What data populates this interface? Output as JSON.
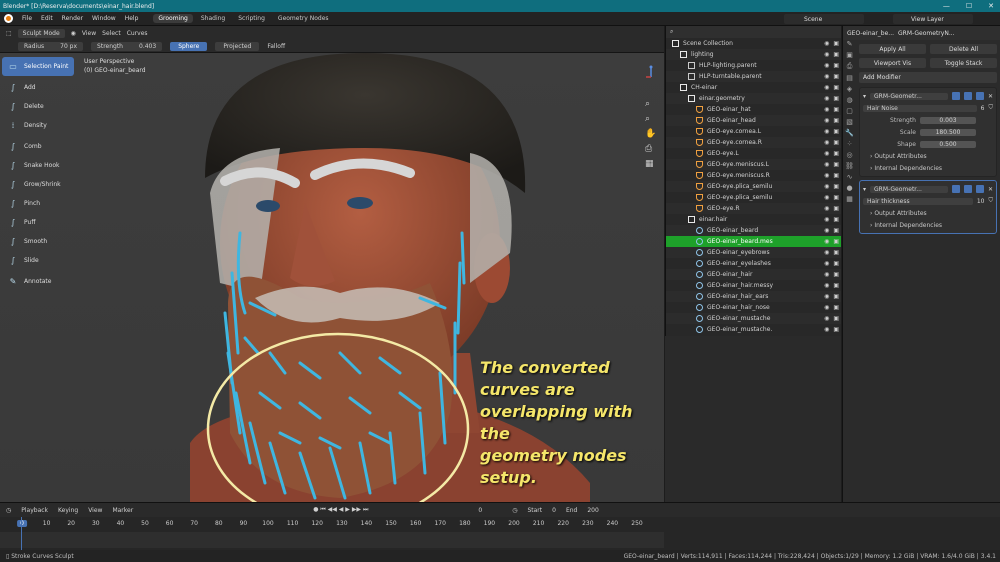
{
  "window": {
    "title": "Blender* [D:\\Reserva\\documents\\einar_hair.blend]",
    "buttons": [
      "—",
      "☐",
      "✕"
    ]
  },
  "menu": [
    "File",
    "Edit",
    "Render",
    "Window",
    "Help"
  ],
  "workspaces": [
    {
      "label": "Grooming",
      "active": true
    },
    {
      "label": "Shading",
      "active": false
    },
    {
      "label": "Scripting",
      "active": false
    },
    {
      "label": "Geometry Nodes",
      "active": false
    }
  ],
  "scene": "Scene",
  "view_layer": "View Layer",
  "tool_header": {
    "mode": "Sculpt Mode",
    "view": "View",
    "select": "Select",
    "curves": "Curves"
  },
  "sub_header": {
    "radius_label": "Radius",
    "radius_value": "70 px",
    "strength_label": "Strength",
    "strength_value": "0.403",
    "sphere": "Sphere",
    "projected": "Projected",
    "falloff": "Falloff"
  },
  "viewport": {
    "perspective": "User Perspective",
    "object": "(0) GEO-einar_beard"
  },
  "tools": [
    {
      "label": "Selection Paint",
      "icon": "selection-paint-icon",
      "glyph": "▭",
      "active": true
    },
    {
      "label": "Add",
      "icon": "add-icon",
      "glyph": "∫",
      "active": false
    },
    {
      "label": "Delete",
      "icon": "delete-icon",
      "glyph": "∫",
      "active": false
    },
    {
      "label": "Density",
      "icon": "density-icon",
      "glyph": "⁞",
      "active": false
    },
    {
      "label": "Comb",
      "icon": "comb-icon",
      "glyph": "∫",
      "active": false
    },
    {
      "label": "Snake Hook",
      "icon": "snake-hook-icon",
      "glyph": "∫",
      "active": false
    },
    {
      "label": "Grow/Shrink",
      "icon": "grow-shrink-icon",
      "glyph": "∫",
      "active": false
    },
    {
      "label": "Pinch",
      "icon": "pinch-icon",
      "glyph": "∫",
      "active": false
    },
    {
      "label": "Puff",
      "icon": "puff-icon",
      "glyph": "∫",
      "active": false
    },
    {
      "label": "Smooth",
      "icon": "smooth-icon",
      "glyph": "∫",
      "active": false
    },
    {
      "label": "Slide",
      "icon": "slide-icon",
      "glyph": "∫",
      "active": false
    },
    {
      "label": "Annotate",
      "icon": "annotate-icon",
      "glyph": "✎",
      "active": false
    }
  ],
  "annotation": [
    "The converted curves are",
    "overlapping with the",
    "geometry nodes setup."
  ],
  "outliner": {
    "rows": [
      {
        "label": "Scene Collection",
        "indent": 0,
        "type": "collection"
      },
      {
        "label": "lighting",
        "indent": 1,
        "type": "collection"
      },
      {
        "label": "HLP-lighting.parent",
        "indent": 2,
        "type": "empty"
      },
      {
        "label": "HLP-turntable.parent",
        "indent": 2,
        "type": "empty"
      },
      {
        "label": "CH-einar",
        "indent": 1,
        "type": "collection"
      },
      {
        "label": "einar.geometry",
        "indent": 2,
        "type": "collection"
      },
      {
        "label": "GEO-einar_hat",
        "indent": 3,
        "type": "mesh"
      },
      {
        "label": "GEO-einar_head",
        "indent": 3,
        "type": "mesh"
      },
      {
        "label": "GEO-eye.cornea.L",
        "indent": 3,
        "type": "mesh"
      },
      {
        "label": "GEO-eye.cornea.R",
        "indent": 3,
        "type": "mesh"
      },
      {
        "label": "GEO-eye.L",
        "indent": 3,
        "type": "mesh"
      },
      {
        "label": "GEO-eye.meniscus.L",
        "indent": 3,
        "type": "mesh"
      },
      {
        "label": "GEO-eye.meniscus.R",
        "indent": 3,
        "type": "mesh"
      },
      {
        "label": "GEO-eye.plica_semilu",
        "indent": 3,
        "type": "mesh"
      },
      {
        "label": "GEO-eye.plica_semilu",
        "indent": 3,
        "type": "mesh"
      },
      {
        "label": "GEO-eye.R",
        "indent": 3,
        "type": "mesh"
      },
      {
        "label": "einar.hair",
        "indent": 2,
        "type": "collection"
      },
      {
        "label": "GEO-einar_beard",
        "indent": 3,
        "type": "curves"
      },
      {
        "label": "GEO-einar_beard.mes",
        "indent": 3,
        "type": "curves",
        "selected": true
      },
      {
        "label": "GEO-einar_eyebrows",
        "indent": 3,
        "type": "curves"
      },
      {
        "label": "GEO-einar_eyelashes",
        "indent": 3,
        "type": "curves"
      },
      {
        "label": "GEO-einar_hair",
        "indent": 3,
        "type": "curves"
      },
      {
        "label": "GEO-einar_hair.messy",
        "indent": 3,
        "type": "curves"
      },
      {
        "label": "GEO-einar_hair_ears",
        "indent": 3,
        "type": "curves"
      },
      {
        "label": "GEO-einar_hair_nose",
        "indent": 3,
        "type": "curves"
      },
      {
        "label": "GEO-einar_mustache",
        "indent": 3,
        "type": "curves"
      },
      {
        "label": "GEO-einar_mustache.",
        "indent": 3,
        "type": "curves"
      }
    ]
  },
  "properties": {
    "object_name": "GEO-einar_be...",
    "modifier_stack": "GRM-GeometryN...",
    "apply_all": "Apply All",
    "delete_all": "Delete All",
    "viewport_vis": "Viewport Vis",
    "toggle_stack": "Toggle Stack",
    "add_modifier": "Add Modifier",
    "modifiers": [
      {
        "name": "GRM-Geometr...",
        "node": "Hair Noise",
        "node_value": "6",
        "params": [
          {
            "label": "Strength",
            "value": "0.003"
          },
          {
            "label": "Scale",
            "value": "180.500"
          },
          {
            "label": "Shape",
            "value": "0.500"
          }
        ],
        "output": "Output Attributes",
        "internal": "Internal Dependencies"
      },
      {
        "name": "GRM-Geometr...",
        "node": "Hair thickness",
        "node_value": "10",
        "params": [],
        "output": "Output Attributes",
        "internal": "Internal Dependencies"
      }
    ]
  },
  "timeline": {
    "menu": [
      "Playback",
      "Keying",
      "View",
      "Marker"
    ],
    "current": "0",
    "current_frame_field": "0",
    "start_label": "Start",
    "start": "0",
    "end_label": "End",
    "end": "200",
    "ticks": [
      "0",
      "10",
      "20",
      "30",
      "40",
      "50",
      "60",
      "70",
      "80",
      "90",
      "100",
      "110",
      "120",
      "130",
      "140",
      "150",
      "160",
      "170",
      "180",
      "190",
      "200",
      "210",
      "220",
      "230",
      "240",
      "250"
    ]
  },
  "status": {
    "left": "Stroke Curves Sculpt",
    "right": "GEO-einar_beard | Verts:114,911 | Faces:114,244 | Tris:228,424 | Objects:1/29 | Memory: 1.2 GiB | VRAM: 1.6/4.0 GiB | 3.4.1"
  },
  "colors": {
    "accent": "#4772b3",
    "selected": "#1ea12a",
    "titlebar": "#0f6e7e",
    "annotation": "#f5e66a",
    "hair": "#3fb6e0"
  }
}
